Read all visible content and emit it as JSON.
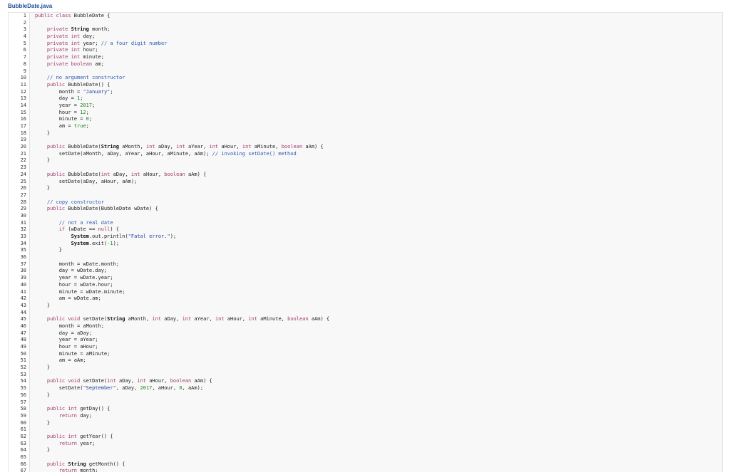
{
  "file": {
    "name": "BubbleDate.java"
  },
  "colors": {
    "keyword": "#a1396a",
    "number": "#1a7f1a",
    "string": "#1b3f9e",
    "comment": "#2b59b5",
    "title": "#1f4f9c"
  },
  "lines": [
    [
      {
        "t": "public class ",
        "c": "kw"
      },
      {
        "t": "BubbleDate {"
      }
    ],
    [],
    [
      {
        "t": "    private ",
        "c": "kw"
      },
      {
        "t": "String",
        "c": "ty"
      },
      {
        "t": " month;"
      }
    ],
    [
      {
        "t": "    private int ",
        "c": "kw"
      },
      {
        "t": "day;"
      }
    ],
    [
      {
        "t": "    private int ",
        "c": "kw"
      },
      {
        "t": "year; "
      },
      {
        "t": "// a four digit number",
        "c": "cm"
      }
    ],
    [
      {
        "t": "    private int ",
        "c": "kw"
      },
      {
        "t": "hour;"
      }
    ],
    [
      {
        "t": "    private int ",
        "c": "kw"
      },
      {
        "t": "minute;"
      }
    ],
    [
      {
        "t": "    private boolean ",
        "c": "kw"
      },
      {
        "t": "am;"
      }
    ],
    [],
    [
      {
        "t": "    // no argument constructor",
        "c": "cm"
      }
    ],
    [
      {
        "t": "    public ",
        "c": "kw"
      },
      {
        "t": "BubbleDate() {"
      }
    ],
    [
      {
        "t": "        month = "
      },
      {
        "t": "\"January\"",
        "c": "str"
      },
      {
        "t": ";"
      }
    ],
    [
      {
        "t": "        day = "
      },
      {
        "t": "1",
        "c": "num"
      },
      {
        "t": ";"
      }
    ],
    [
      {
        "t": "        year = "
      },
      {
        "t": "2017",
        "c": "num"
      },
      {
        "t": ";"
      }
    ],
    [
      {
        "t": "        hour = "
      },
      {
        "t": "12",
        "c": "num"
      },
      {
        "t": ";"
      }
    ],
    [
      {
        "t": "        minute = "
      },
      {
        "t": "0",
        "c": "num"
      },
      {
        "t": ";"
      }
    ],
    [
      {
        "t": "        am = "
      },
      {
        "t": "true",
        "c": "lit"
      },
      {
        "t": ";"
      }
    ],
    [
      {
        "t": "    }"
      }
    ],
    [],
    [
      {
        "t": "    public ",
        "c": "kw"
      },
      {
        "t": "BubbleDate("
      },
      {
        "t": "String",
        "c": "ty"
      },
      {
        "t": " aMonth, "
      },
      {
        "t": "int",
        "c": "kw"
      },
      {
        "t": " aDay, "
      },
      {
        "t": "int",
        "c": "kw"
      },
      {
        "t": " aYear, "
      },
      {
        "t": "int",
        "c": "kw"
      },
      {
        "t": " aHour, "
      },
      {
        "t": "int",
        "c": "kw"
      },
      {
        "t": " aMinute, "
      },
      {
        "t": "boolean",
        "c": "kw"
      },
      {
        "t": " aAm) {"
      }
    ],
    [
      {
        "t": "        setDate(aMonth, aDay, aYear, aHour, aMinute, aAm); "
      },
      {
        "t": "// invoking setDate() method",
        "c": "cm"
      }
    ],
    [
      {
        "t": "    }"
      }
    ],
    [],
    [
      {
        "t": "    public ",
        "c": "kw"
      },
      {
        "t": "BubbleDate("
      },
      {
        "t": "int",
        "c": "kw"
      },
      {
        "t": " aDay, "
      },
      {
        "t": "int",
        "c": "kw"
      },
      {
        "t": " aHour, "
      },
      {
        "t": "boolean",
        "c": "kw"
      },
      {
        "t": " aAm) {"
      }
    ],
    [
      {
        "t": "        setDate(aDay, aHour, aAm);"
      }
    ],
    [
      {
        "t": "    }"
      }
    ],
    [],
    [
      {
        "t": "    // copy constructor",
        "c": "cm"
      }
    ],
    [
      {
        "t": "    public ",
        "c": "kw"
      },
      {
        "t": "BubbleDate(BubbleDate wDate) {"
      }
    ],
    [],
    [
      {
        "t": "        // not a real date",
        "c": "cm"
      }
    ],
    [
      {
        "t": "        if ",
        "c": "kw"
      },
      {
        "t": "(wDate == "
      },
      {
        "t": "null",
        "c": "kw"
      },
      {
        "t": ") {"
      }
    ],
    [
      {
        "t": "            "
      },
      {
        "t": "System",
        "c": "ty"
      },
      {
        "t": ".out.println("
      },
      {
        "t": "\"Fatal error.\"",
        "c": "str"
      },
      {
        "t": ");"
      }
    ],
    [
      {
        "t": "            "
      },
      {
        "t": "System",
        "c": "ty"
      },
      {
        "t": ".exit("
      },
      {
        "t": "-1",
        "c": "num"
      },
      {
        "t": ");"
      }
    ],
    [
      {
        "t": "        }"
      }
    ],
    [],
    [
      {
        "t": "        month = wDate.month;"
      }
    ],
    [
      {
        "t": "        day = wDate.day;"
      }
    ],
    [
      {
        "t": "        year = wDate.year;"
      }
    ],
    [
      {
        "t": "        hour = wDate.hour;"
      }
    ],
    [
      {
        "t": "        minute = wDate.minute;"
      }
    ],
    [
      {
        "t": "        am = wDate.am;"
      }
    ],
    [
      {
        "t": "    }"
      }
    ],
    [],
    [
      {
        "t": "    public void ",
        "c": "kw"
      },
      {
        "t": "setDate("
      },
      {
        "t": "String",
        "c": "ty"
      },
      {
        "t": " aMonth, "
      },
      {
        "t": "int",
        "c": "kw"
      },
      {
        "t": " aDay, "
      },
      {
        "t": "int",
        "c": "kw"
      },
      {
        "t": " aYear, "
      },
      {
        "t": "int",
        "c": "kw"
      },
      {
        "t": " aHour, "
      },
      {
        "t": "int",
        "c": "kw"
      },
      {
        "t": " aMinute, "
      },
      {
        "t": "boolean",
        "c": "kw"
      },
      {
        "t": " aAm) {"
      }
    ],
    [
      {
        "t": "        month = aMonth;"
      }
    ],
    [
      {
        "t": "        day = aDay;"
      }
    ],
    [
      {
        "t": "        year = aYear;"
      }
    ],
    [
      {
        "t": "        hour = aHour;"
      }
    ],
    [
      {
        "t": "        minute = aMinute;"
      }
    ],
    [
      {
        "t": "        am = aAm;"
      }
    ],
    [
      {
        "t": "    }"
      }
    ],
    [],
    [
      {
        "t": "    public void ",
        "c": "kw"
      },
      {
        "t": "setDate("
      },
      {
        "t": "int",
        "c": "kw"
      },
      {
        "t": " aDay, "
      },
      {
        "t": "int",
        "c": "kw"
      },
      {
        "t": " aHour, "
      },
      {
        "t": "boolean",
        "c": "kw"
      },
      {
        "t": " aAm) {"
      }
    ],
    [
      {
        "t": "        setDate("
      },
      {
        "t": "\"September\"",
        "c": "str"
      },
      {
        "t": ", aDay, "
      },
      {
        "t": "2017",
        "c": "num"
      },
      {
        "t": ", aHour, "
      },
      {
        "t": "0",
        "c": "num"
      },
      {
        "t": ", aAm);"
      }
    ],
    [
      {
        "t": "    }"
      }
    ],
    [],
    [
      {
        "t": "    public int ",
        "c": "kw"
      },
      {
        "t": "getDay() {"
      }
    ],
    [
      {
        "t": "        return ",
        "c": "kw"
      },
      {
        "t": "day;"
      }
    ],
    [
      {
        "t": "    }"
      }
    ],
    [],
    [
      {
        "t": "    public int ",
        "c": "kw"
      },
      {
        "t": "getYear() {"
      }
    ],
    [
      {
        "t": "        return ",
        "c": "kw"
      },
      {
        "t": "year;"
      }
    ],
    [
      {
        "t": "    }"
      }
    ],
    [],
    [
      {
        "t": "    public ",
        "c": "kw"
      },
      {
        "t": "String",
        "c": "ty"
      },
      {
        "t": " getMonth() {"
      }
    ],
    [
      {
        "t": "        return ",
        "c": "kw"
      },
      {
        "t": "month;"
      }
    ],
    [
      {
        "t": "    }"
      }
    ]
  ]
}
